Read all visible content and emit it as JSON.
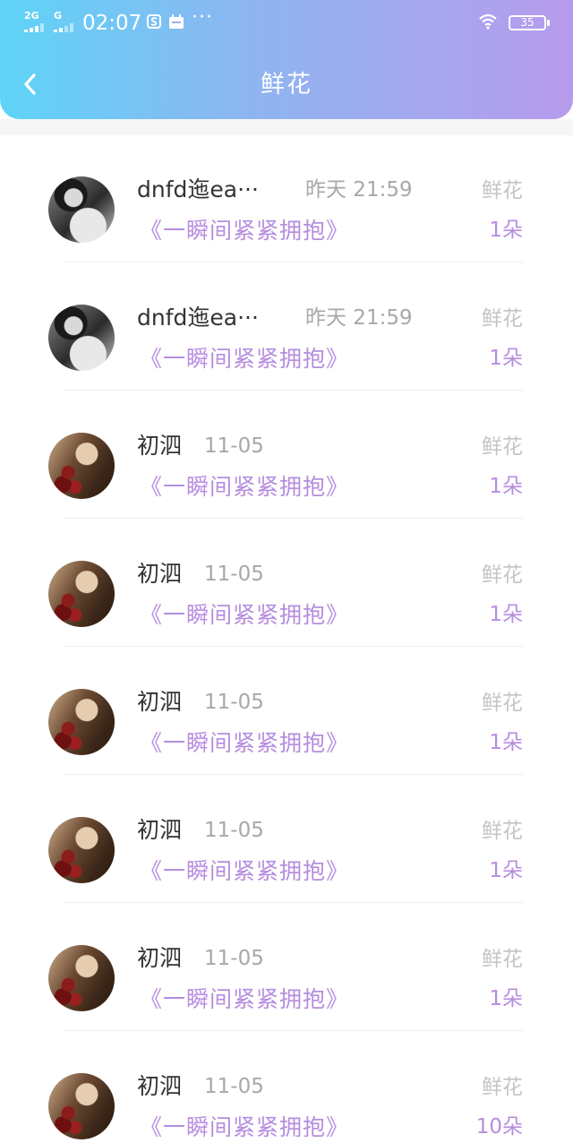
{
  "status_bar": {
    "signal1_label": "2G",
    "signal2_label": "G",
    "time": "02:07",
    "more": "···",
    "battery": "35",
    "icons": [
      "signal-icon",
      "signal-icon",
      "s-app-icon",
      "calendar-icon",
      "wifi-icon",
      "battery-icon"
    ]
  },
  "header": {
    "back_icon": "chevron-left-icon",
    "title": "鲜花"
  },
  "colors": {
    "gradient_start": "#5ed4f7",
    "gradient_end": "#b79bec",
    "accent": "#b68ddf",
    "name_text": "#333333",
    "muted_text": "#a8a8a8"
  },
  "items": [
    {
      "name": "dnfd迤ea···",
      "time": "昨天 21:59",
      "kind": "鲜花",
      "song": "《一瞬间紧紧拥抱》",
      "count": "1朵"
    },
    {
      "name": "dnfd迤ea···",
      "time": "昨天 21:59",
      "kind": "鲜花",
      "song": "《一瞬间紧紧拥抱》",
      "count": "1朵"
    },
    {
      "name": "初泗",
      "time": "11-05",
      "kind": "鲜花",
      "song": "《一瞬间紧紧拥抱》",
      "count": "1朵"
    },
    {
      "name": "初泗",
      "time": "11-05",
      "kind": "鲜花",
      "song": "《一瞬间紧紧拥抱》",
      "count": "1朵"
    },
    {
      "name": "初泗",
      "time": "11-05",
      "kind": "鲜花",
      "song": "《一瞬间紧紧拥抱》",
      "count": "1朵"
    },
    {
      "name": "初泗",
      "time": "11-05",
      "kind": "鲜花",
      "song": "《一瞬间紧紧拥抱》",
      "count": "1朵"
    },
    {
      "name": "初泗",
      "time": "11-05",
      "kind": "鲜花",
      "song": "《一瞬间紧紧拥抱》",
      "count": "1朵"
    },
    {
      "name": "初泗",
      "time": "11-05",
      "kind": "鲜花",
      "song": "《一瞬间紧紧拥抱》",
      "count": "10朵"
    }
  ]
}
